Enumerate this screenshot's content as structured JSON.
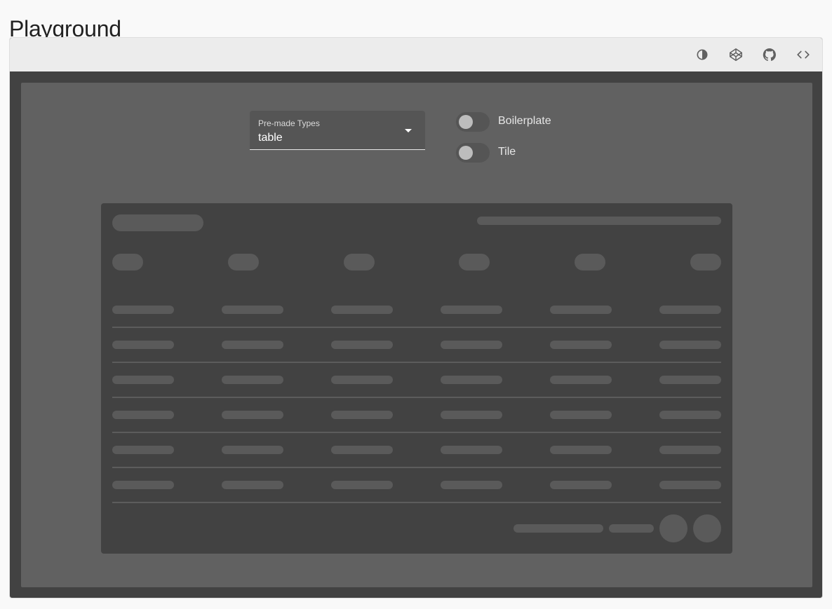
{
  "page": {
    "title": "Playground"
  },
  "toolbar": {
    "buttons": [
      {
        "icon": "theme-toggle-icon"
      },
      {
        "icon": "codepen-icon"
      },
      {
        "icon": "github-icon"
      },
      {
        "icon": "code-icon"
      }
    ]
  },
  "controls": {
    "type_select": {
      "label": "Pre-made Types",
      "value": "table"
    },
    "boilerplate_switch": {
      "label": "Boilerplate",
      "checked": false
    },
    "tile_switch": {
      "label": "Tile",
      "checked": false
    }
  },
  "preview": {
    "skeleton_type": "table",
    "column_count": 6,
    "row_count": 6
  },
  "colors": {
    "page_background": "#f9f9f9",
    "toolbar": "#ececec",
    "frame": "#424242",
    "stage": "#616161",
    "skeleton_bone": "#5a5a5a"
  }
}
